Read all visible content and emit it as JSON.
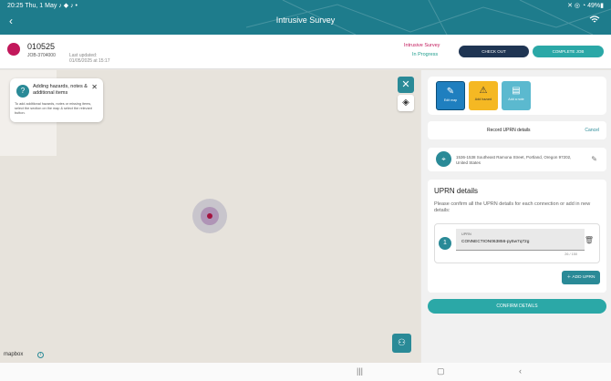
{
  "status_bar": {
    "left": "20:25  Thu, 1 May  ♪ ◆ ♪ •",
    "right": "✕ ◎ ◔ 49%▮"
  },
  "header": {
    "title": "Intrusive Survey"
  },
  "job": {
    "number": "010525",
    "reference": "JOB-3704000",
    "last_updated_label": "Last updated:",
    "last_updated_value": "01/05/2025 at 15:17",
    "survey_link": "Intrusive Survey",
    "status": "In Progress",
    "check_out_label": "CHECK OUT",
    "complete_label": "COMPLETE JOB"
  },
  "tip": {
    "title": "Adding hazards, notes & additional items",
    "body": "To add additional hazards, notes or missing items, select the section on the map & select the relevant button."
  },
  "map": {
    "attribution": "mapbox"
  },
  "categories": [
    {
      "label": "Edit map",
      "icon": "pencil-icon"
    },
    {
      "label": "Add hazard",
      "icon": "hazard-icon"
    },
    {
      "label": "Add a note",
      "icon": "note-icon"
    }
  ],
  "uprn_bar": {
    "label": "Record UPRN details",
    "cancel": "Cancel"
  },
  "address": {
    "line": "1536-1538 Southeast Ramona Street, Portland, Oregon 97202, United States"
  },
  "details": {
    "heading": "UPRN details",
    "description": "Please confirm all the UPRN details for each connection or add in new details:",
    "connections": [
      {
        "num": "1",
        "field_label": "UPRN",
        "value": "CONNECTION063856-py5w7q72g",
        "count": "26 / 150"
      }
    ],
    "add_label": "ADD UPRN"
  },
  "confirm_label": "CONFIRM DETAILS"
}
